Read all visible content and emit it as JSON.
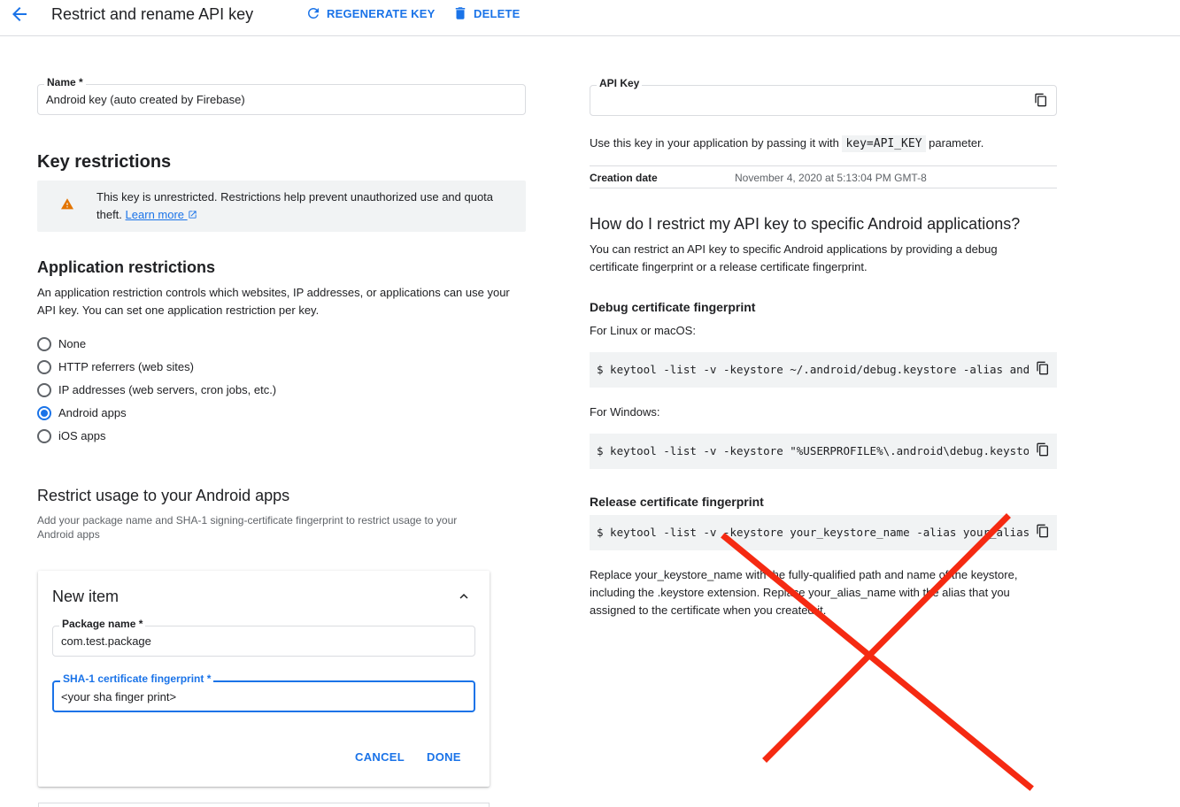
{
  "header": {
    "title": "Restrict and rename API key",
    "regenerate_label": "REGENERATE KEY",
    "delete_label": "DELETE"
  },
  "name_field": {
    "label": "Name *",
    "value": "Android key (auto created by Firebase)"
  },
  "key_restrictions": {
    "heading": "Key restrictions",
    "warning_text": "This key is unrestricted. Restrictions help prevent unauthorized use and quota theft.",
    "learn_more": "Learn more"
  },
  "application_restrictions": {
    "heading": "Application restrictions",
    "description": "An application restriction controls which websites, IP addresses, or applications can use your API key. You can set one application restriction per key.",
    "options": [
      {
        "label": "None",
        "checked": false
      },
      {
        "label": "HTTP referrers (web sites)",
        "checked": false
      },
      {
        "label": "IP addresses (web servers, cron jobs, etc.)",
        "checked": false
      },
      {
        "label": "Android apps",
        "checked": true
      },
      {
        "label": "iOS apps",
        "checked": false
      }
    ]
  },
  "android_usage": {
    "heading": "Restrict usage to your Android apps",
    "description": "Add your package name and SHA-1 signing-certificate fingerprint to restrict usage to your Android apps"
  },
  "new_item": {
    "title": "New item",
    "package_label": "Package name *",
    "package_value": "com.test.package",
    "sha_label": "SHA-1 certificate fingerprint *",
    "sha_value": "<your sha finger print>",
    "cancel_label": "CANCEL",
    "done_label": "DONE"
  },
  "api_key": {
    "label": "API Key",
    "value": "",
    "usage_prefix": "Use this key in your application by passing it with",
    "usage_code": "key=API_KEY",
    "usage_suffix": "parameter.",
    "creation_label": "Creation date",
    "creation_value": "November 4, 2020 at 5:13:04 PM GMT-8"
  },
  "help": {
    "heading": "How do I restrict my API key to specific Android applications?",
    "intro": "You can restrict an API key to specific Android applications by providing a debug certificate fingerprint or a release certificate fingerprint.",
    "debug_heading": "Debug certificate fingerprint",
    "linux_label": "For Linux or macOS:",
    "linux_command": "$ keytool -list -v -keystore ~/.android/debug.keystore -alias androiddebugkey -storepass android -keypass android",
    "windows_label": "For Windows:",
    "windows_command": "$ keytool -list -v -keystore \"%USERPROFILE%\\.android\\debug.keystore\" -alias androiddebugkey -storepass android -keypass android",
    "release_heading": "Release certificate fingerprint",
    "release_command": "$ keytool -list -v -keystore your_keystore_name -alias your_alias_name",
    "replace_text": "Replace your_keystore_name with the fully-qualified path and name of the keystore, including the .keystore extension. Replace your_alias_name with the alias that you assigned to the certificate when you created it."
  },
  "colors": {
    "accent": "#1a73e8",
    "warning": "#e37400",
    "annotation_x": "#f52a12"
  }
}
